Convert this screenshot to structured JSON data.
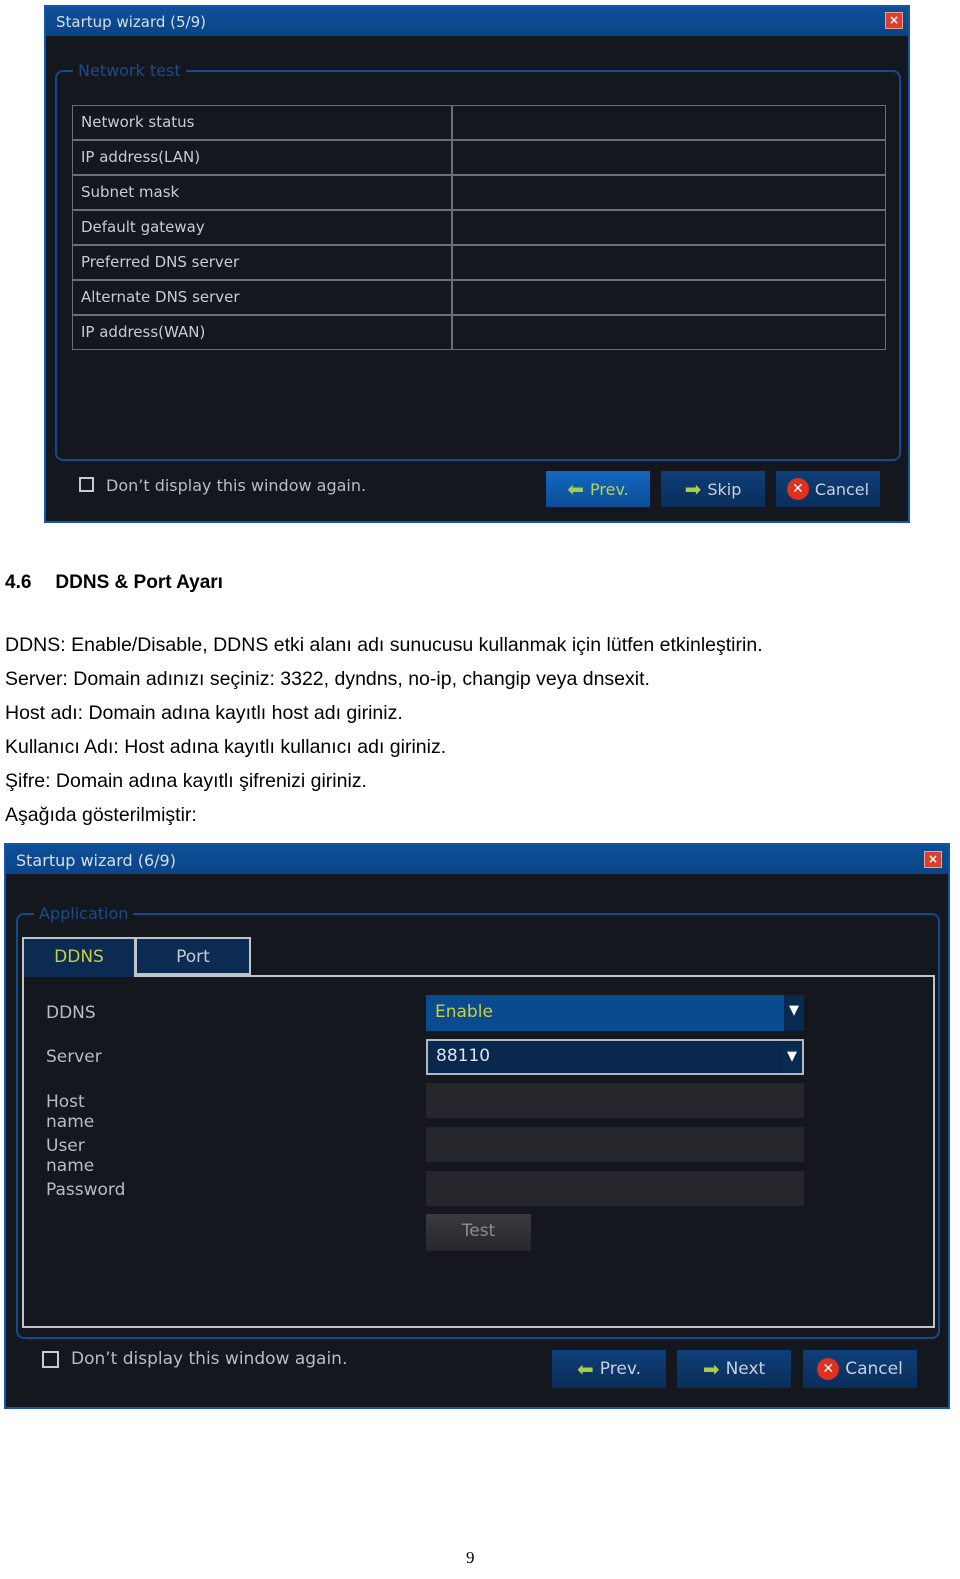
{
  "wizard1": {
    "title": "Startup wizard (5/9)",
    "section": "Network test",
    "rows": [
      {
        "label": "Network status",
        "value": ""
      },
      {
        "label": "IP address(LAN)",
        "value": ""
      },
      {
        "label": "Subnet mask",
        "value": ""
      },
      {
        "label": "Default gateway",
        "value": ""
      },
      {
        "label": "Preferred DNS server",
        "value": ""
      },
      {
        "label": "Alternate DNS server",
        "value": ""
      },
      {
        "label": "IP address(WAN)",
        "value": ""
      }
    ],
    "checkbox_label": "Don’t display this window again.",
    "checkbox_checked": false,
    "prev": "Prev.",
    "skip": "Skip",
    "cancel": "Cancel",
    "close": "×"
  },
  "section": {
    "number": "4.6",
    "title": "DDNS & Port Ayarı"
  },
  "paragraphs": [
    "DDNS: Enable/Disable, DDNS etki alanı adı sunucusu kullanmak için lütfen etkinleştirin.",
    "Server: Domain adınızı seçiniz: 3322, dyndns, no-ip, changip veya dnsexit.",
    "Host adı: Domain adına kayıtlı host adı giriniz.",
    "Kullanıcı Adı: Host adına kayıtlı kullanıcı adı giriniz.",
    "Şifre: Domain adına kayıtlı şifrenizi giriniz.",
    "Aşağıda gösterilmiştir:"
  ],
  "wizard2": {
    "title": "Startup wizard (6/9)",
    "section": "Application",
    "tabs": [
      "DDNS",
      "Port"
    ],
    "active_tab": "DDNS",
    "fields": {
      "ddns_label": "DDNS",
      "ddns_value": "Enable",
      "server_label": "Server",
      "server_value": "88110",
      "host_label": "Host name",
      "host_value": "",
      "user_label": "User name",
      "user_value": "",
      "password_label": "Password",
      "password_value": ""
    },
    "test": "Test",
    "checkbox_label": "Don’t display this window again.",
    "checkbox_checked": false,
    "prev": "Prev.",
    "next": "Next",
    "cancel": "Cancel",
    "close": "×"
  },
  "page_number": "9"
}
